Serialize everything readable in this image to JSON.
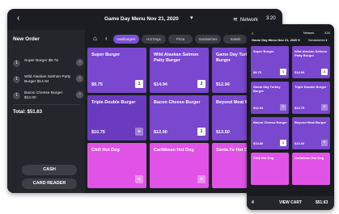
{
  "tablet": {
    "header": {
      "back_icon": "chevron-left",
      "title": "Game Day Menu Nov 21, 2020",
      "caret": "▾",
      "network": "Network",
      "time": "3:20"
    },
    "order": {
      "heading": "New Order",
      "items": [
        {
          "qty": "1",
          "name": "Super Burger $9.75"
        },
        {
          "qty": "1",
          "name": "Wild Alaskan Salmon Patty Burger $14.94"
        },
        {
          "qty": "1",
          "name": "Bacon Cheese Burger $12.00"
        }
      ],
      "total": "Total: $51.63",
      "cash_label": "CASH",
      "card_reader_label": "CARD READER"
    },
    "categories": [
      "Hamburgers",
      "Hot Dogs",
      "Pizza",
      "Sandwiches",
      "Salads"
    ],
    "active_category": "Hamburgers",
    "tiles": [
      {
        "name": "Super Burger",
        "price": "$9.75",
        "qty": "1"
      },
      {
        "name": "Wild Alaskan Salmon Patty Burger",
        "price": "$14.94",
        "qty": "2"
      },
      {
        "name": "Game Day Turkey Burger",
        "price": "$12.94",
        "qty": ""
      },
      {
        "name": "Triple Double Burger",
        "price": "$10.75",
        "qty": ""
      },
      {
        "name": "Bacon Cheese Burger",
        "price": "$12.00",
        "qty": "1"
      },
      {
        "name": "Beyond Meat Burger",
        "price": "$13.50",
        "qty": ""
      },
      {
        "name": "Chili Hot Dog",
        "price": "",
        "qty": ""
      },
      {
        "name": "Caribbean Hot Dog",
        "price": "",
        "qty": ""
      },
      {
        "name": "Santa Fe Hot Dog",
        "price": "",
        "qty": ""
      }
    ]
  },
  "phone": {
    "menu_icon": "menu",
    "network": "Network",
    "time": "3:20",
    "title": "Game Day Menu Nov 21, 2020 ▾",
    "filter": "Sandwiches ▾",
    "tiles": [
      {
        "name": "Super Burger",
        "price": "$9.75",
        "qty": "1"
      },
      {
        "name": "Wild Alaskan Salmon Patty Burger",
        "price": "$14.94",
        "qty": "2"
      },
      {
        "name": "Game Day Turkey Burger",
        "price": "$12.94",
        "qty": ""
      },
      {
        "name": "Triple Double Burger",
        "price": "$10.75",
        "qty": ""
      },
      {
        "name": "Bacon Cheese Burger",
        "price": "$13.80",
        "qty": "1"
      },
      {
        "name": "Beyond Meat Burger",
        "price": "$13.50",
        "qty": ""
      },
      {
        "name": "Chili Hot Dog",
        "price": "",
        "qty": ""
      },
      {
        "name": "Caribbean Hot Dog",
        "price": "",
        "qty": ""
      }
    ],
    "cart_count": "4",
    "view_cart_label": "VIEW CART",
    "cart_total": "$51.63"
  },
  "colors": {
    "tile_purple": "#7a47cf",
    "tile_pink": "#e153e6",
    "active_tab": "#7b4fd6",
    "background_dark": "#1c1d22"
  }
}
